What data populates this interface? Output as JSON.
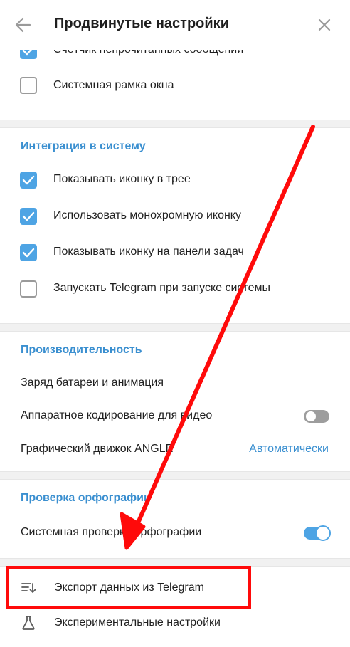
{
  "header": {
    "title": "Продвинутые настройки",
    "back_icon": "arrow-left-icon",
    "close_icon": "close-icon"
  },
  "window_section": {
    "items": [
      {
        "label": "Счётчик непрочитанных сообщений",
        "checked": true
      },
      {
        "label": "Системная рамка окна",
        "checked": false
      }
    ]
  },
  "integration": {
    "title": "Интеграция в систему",
    "items": [
      {
        "label": "Показывать иконку в трее",
        "checked": true
      },
      {
        "label": "Использовать монохромную иконку",
        "checked": true
      },
      {
        "label": "Показывать иконку на панели задач",
        "checked": true
      },
      {
        "label": "Запускать Telegram при запуске системы",
        "checked": false
      }
    ]
  },
  "performance": {
    "title": "Производительность",
    "battery_label": "Заряд батареи и анимация",
    "hw_decoding_label": "Аппаратное кодирование для видео",
    "hw_decoding_enabled": false,
    "angle_label": "Графический движок ANGLE",
    "angle_value": "Автоматически"
  },
  "spellcheck": {
    "title": "Проверка орфографии",
    "system_label": "Системная проверка орфографии",
    "system_enabled": true
  },
  "actions": {
    "export_label": "Экспорт данных из Telegram",
    "export_icon": "export-data-icon",
    "experimental_label": "Экспериментальные настройки",
    "experimental_icon": "flask-icon"
  },
  "colors": {
    "accent": "#3a8fd0",
    "checkbox_on": "#4ea4e4",
    "annotation_red": "#ff0a0a",
    "divider": "#f1f1f1"
  }
}
